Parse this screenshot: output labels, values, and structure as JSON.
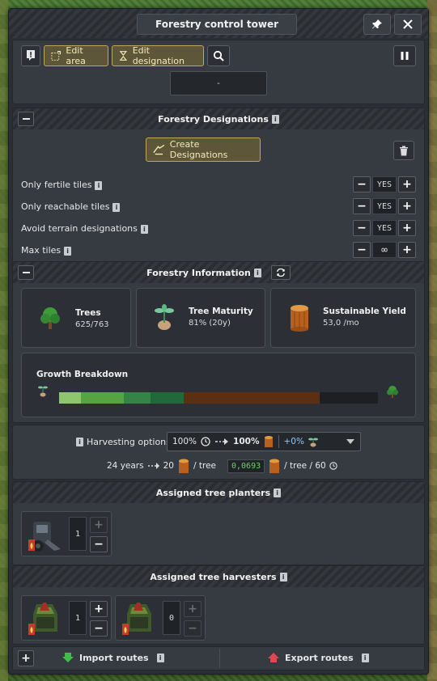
{
  "window": {
    "title": "Forestry control tower",
    "pin_icon": "pin-icon",
    "close_icon": "close-icon"
  },
  "toolbar": {
    "notes_icon": "notes-icon",
    "edit_area_label": "Edit area",
    "edit_designation_label": "Edit designation",
    "search_icon": "search-icon",
    "pause_icon": "pause-icon",
    "name_value": "-"
  },
  "designations": {
    "title": "Forestry Designations",
    "create_label": "Create Designations",
    "rows": [
      {
        "label": "Only fertile tiles",
        "value": "YES"
      },
      {
        "label": "Only reachable tiles",
        "value": "YES"
      },
      {
        "label": "Avoid terrain designations",
        "value": "YES"
      },
      {
        "label": "Max tiles",
        "value": "∞"
      }
    ]
  },
  "information": {
    "title": "Forestry Information",
    "cards": [
      {
        "label": "Trees",
        "value": "625/763"
      },
      {
        "label": "Tree Maturity",
        "value": "81% (20y)"
      },
      {
        "label": "Sustainable Yield",
        "value": "53,0 /mo"
      }
    ],
    "growth_title": "Growth Breakdown",
    "growth_segments": [
      {
        "fraction": 0.068,
        "color": "#8fc56f"
      },
      {
        "fraction": 0.135,
        "color": "#56a344"
      },
      {
        "fraction": 0.085,
        "color": "#348447"
      },
      {
        "fraction": 0.102,
        "color": "#21683a"
      },
      {
        "fraction": 0.428,
        "color": "#5b2f12"
      },
      {
        "fraction": 0.182,
        "color": "#1d1f22"
      }
    ]
  },
  "harvesting": {
    "label": "Harvesting options:",
    "option_time": "100%",
    "option_wood": "100%",
    "option_bonus": "+0%",
    "years_text": "24 years",
    "yield_text": "20",
    "per_tree_text": "/ tree",
    "rate_value": "0,0693",
    "rate_suffix": "/ tree / 60"
  },
  "planters": {
    "title": "Assigned tree planters",
    "vehicles": [
      {
        "count": "1"
      }
    ]
  },
  "harvesters": {
    "title": "Assigned tree harvesters",
    "vehicles": [
      {
        "count": "1"
      },
      {
        "count": "0"
      }
    ]
  },
  "routes": {
    "import_label": "Import routes",
    "export_label": "Export routes"
  },
  "colors": {
    "accent_yellow": "#bfa65c",
    "panel": "#363a41",
    "rate_green": "#6fd06a"
  }
}
